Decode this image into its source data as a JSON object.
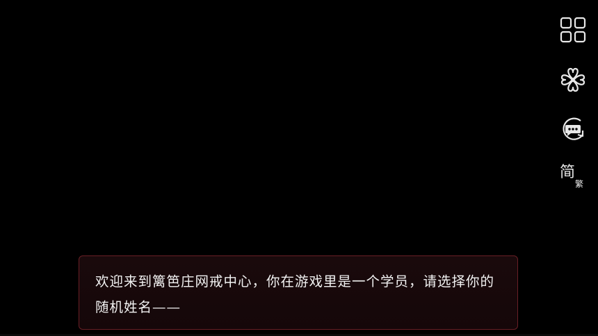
{
  "side_menu": {
    "menu_icon": "grid-menu-icon",
    "clover_icon": "clover-icon",
    "chat_icon": "chat-refresh-icon",
    "lang_main": "简",
    "lang_sub": "繁"
  },
  "dialog": {
    "text": "欢迎来到篱笆庄网戒中心，你在游戏里是一个学员，请选择你的随机姓名——"
  },
  "colors": {
    "background": "#000000",
    "dialog_border": "#6a1f26",
    "dialog_bg": "#1a0a0c",
    "text": "#f2f2f2",
    "icon": "#e8e8e8"
  }
}
